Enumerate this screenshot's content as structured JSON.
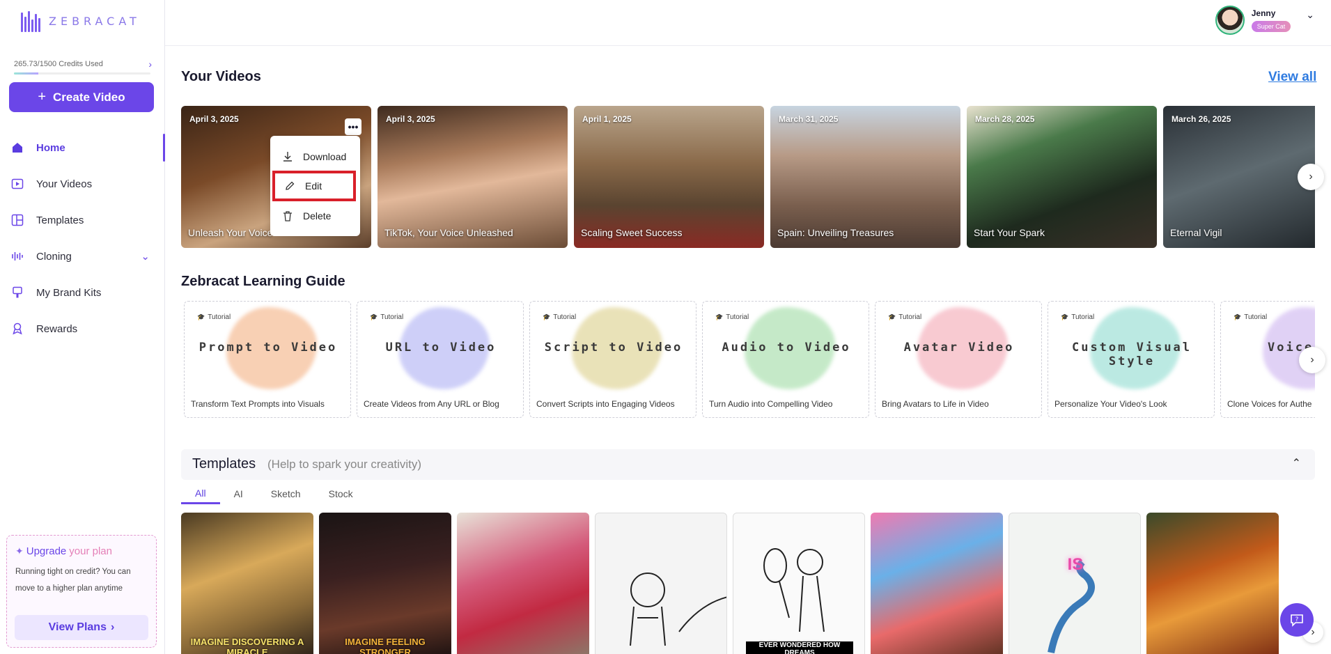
{
  "brand": {
    "name": "ZEBRACAT"
  },
  "user": {
    "name": "Jenny",
    "badge": "Super Cat"
  },
  "credits": {
    "label": "265.73/1500 Credits Used",
    "used": 265.73,
    "total": 1500
  },
  "sidebar": {
    "create_label": "Create Video",
    "items": [
      {
        "label": "Home",
        "icon": "home-icon"
      },
      {
        "label": "Your Videos",
        "icon": "video-icon"
      },
      {
        "label": "Templates",
        "icon": "templates-icon"
      },
      {
        "label": "Cloning",
        "icon": "waveform-icon"
      },
      {
        "label": "My Brand Kits",
        "icon": "brush-icon"
      },
      {
        "label": "Rewards",
        "icon": "trophy-icon"
      }
    ],
    "upgrade": {
      "title_1": "Upgrade",
      "title_2": "your plan",
      "text": "Running tight on credit? You can move to a higher plan anytime",
      "button": "View Plans"
    }
  },
  "videos": {
    "title": "Your Videos",
    "view_all": "View all",
    "items": [
      {
        "date": "April 3, 2025",
        "title": "Unleash Your Voice"
      },
      {
        "date": "April 3, 2025",
        "title": "TikTok, Your Voice Unleashed"
      },
      {
        "date": "April 1, 2025",
        "title": "Scaling Sweet Success"
      },
      {
        "date": "March 31, 2025",
        "title": "Spain: Unveiling Treasures"
      },
      {
        "date": "March 28, 2025",
        "title": "Start Your Spark"
      },
      {
        "date": "March 26, 2025",
        "title": "Eternal Vigil"
      }
    ],
    "menu": {
      "download": "Download",
      "edit": "Edit",
      "delete": "Delete"
    }
  },
  "guide": {
    "title": "Zebracat Learning Guide",
    "tag": "Tutorial",
    "items": [
      {
        "title": "Prompt to Video",
        "subtitle": "Transform Text Prompts into Visuals",
        "color": "#f4b183"
      },
      {
        "title": "URL to Video",
        "subtitle": "Create Videos from Any URL or Blog",
        "color": "#aeb0f4"
      },
      {
        "title": "Script to Video",
        "subtitle": "Convert Scripts into Engaging Videos",
        "color": "#dccf8a"
      },
      {
        "title": "Audio to Video",
        "subtitle": "Turn Audio into Compelling Video",
        "color": "#9fdca4"
      },
      {
        "title": "Avatar Video",
        "subtitle": "Bring Avatars to Life in Video",
        "color": "#f4a7b4"
      },
      {
        "title": "Custom Visual Style",
        "subtitle": "Personalize Your Video's Look",
        "color": "#8fdcd0"
      },
      {
        "title": "Voice Cl",
        "subtitle": "Clone Voices for Authe",
        "color": "#cdb3f0"
      }
    ]
  },
  "templates": {
    "title": "Templates",
    "subtitle": "(Help to spark your creativity)",
    "tabs": [
      "All",
      "AI",
      "Sketch",
      "Stock"
    ],
    "captions": [
      "IMAGINE DISCOVERING A MIRACLE",
      "IMAGINE FEELING STRONGER",
      "",
      "",
      "EVER WONDERED HOW DREAMS",
      "",
      "IS",
      ""
    ]
  }
}
